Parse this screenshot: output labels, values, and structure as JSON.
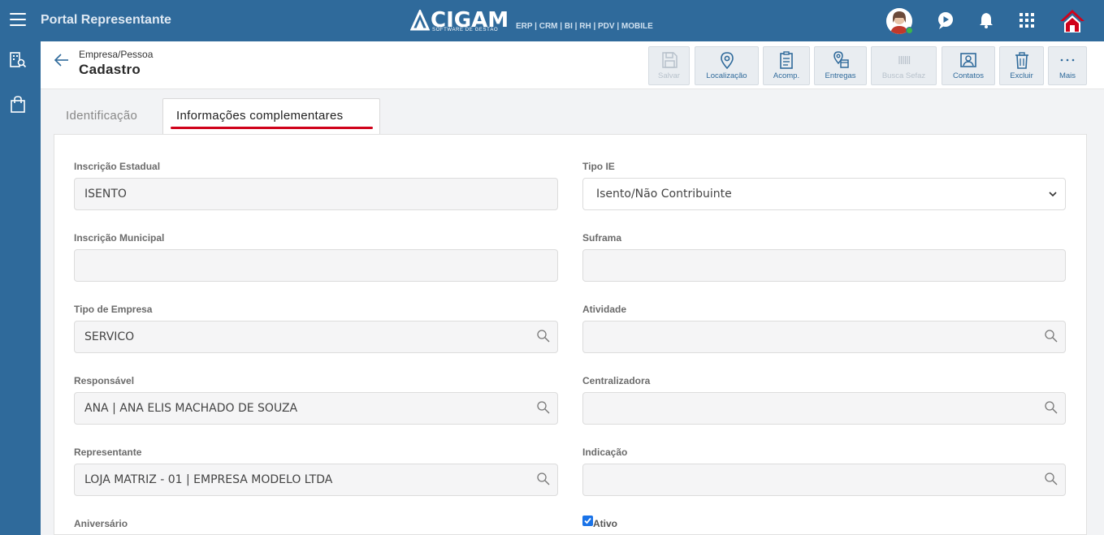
{
  "header": {
    "app_title": "Portal Representante",
    "brand": {
      "name": "CIGAM",
      "subtitle": "SOFTWARE DE GESTÃO",
      "modules": "ERP | CRM | BI | RH | PDV | MOBILE"
    }
  },
  "page": {
    "breadcrumb": "Empresa/Pessoa",
    "title": "Cadastro"
  },
  "toolbar": {
    "salvar": "Salvar",
    "localizacao": "Localização",
    "acomp": "Acomp.",
    "entregas": "Entregas",
    "busca_sefaz": "Busca Sefaz",
    "contatos": "Contatos",
    "excluir": "Excluir",
    "mais": "Mais"
  },
  "tabs": {
    "identificacao": "Identificação",
    "informacoes": "Informações complementares"
  },
  "form": {
    "inscricao_estadual": {
      "label": "Inscrição Estadual",
      "value": "ISENTO"
    },
    "tipo_ie": {
      "label": "Tipo IE",
      "value": "Isento/Não Contribuinte"
    },
    "inscricao_municipal": {
      "label": "Inscrição Municipal",
      "value": ""
    },
    "suframa": {
      "label": "Suframa",
      "value": ""
    },
    "tipo_empresa": {
      "label": "Tipo de Empresa",
      "value": "SERVICO"
    },
    "atividade": {
      "label": "Atividade",
      "value": ""
    },
    "responsavel": {
      "label": "Responsável",
      "value": "ANA | ANA ELIS MACHADO DE SOUZA"
    },
    "centralizadora": {
      "label": "Centralizadora",
      "value": ""
    },
    "representante": {
      "label": "Representante",
      "value": "LOJA MATRIZ - 01 | EMPRESA MODELO LTDA"
    },
    "indicacao": {
      "label": "Indicação",
      "value": ""
    },
    "aniversario": {
      "label": "Aniversário"
    },
    "ativo": {
      "label": "Ativo",
      "checked": true
    }
  },
  "colors": {
    "primary": "#2f6a9b",
    "accent_red": "#d0021b",
    "check_blue": "#1a73e8"
  }
}
